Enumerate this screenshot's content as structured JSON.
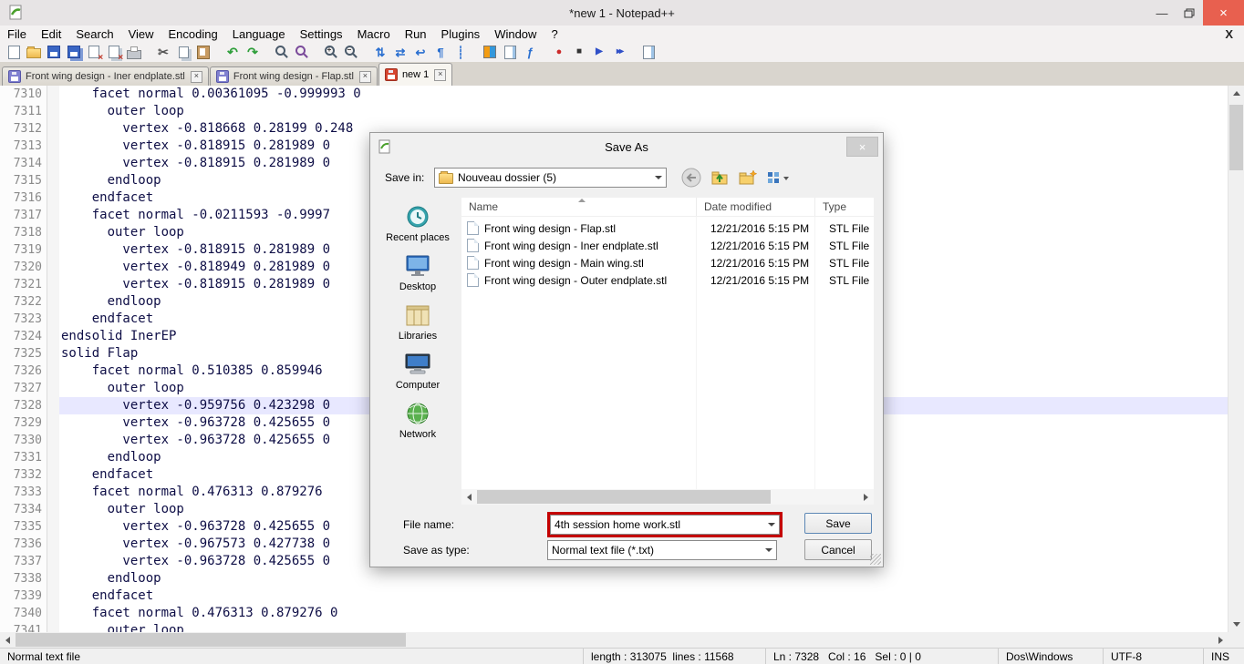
{
  "window": {
    "title": "*new 1 - Notepad++",
    "controls": {
      "minimize": "—",
      "close": "×"
    },
    "menu_close": "X"
  },
  "menu": [
    "File",
    "Edit",
    "Search",
    "View",
    "Encoding",
    "Language",
    "Settings",
    "Macro",
    "Run",
    "Plugins",
    "Window",
    "?"
  ],
  "toolbar": [
    {
      "name": "new-file-icon",
      "cls": "tbi-new",
      "glyph": ""
    },
    {
      "name": "open-file-icon",
      "cls": "tbi-open",
      "glyph": ""
    },
    {
      "name": "save-icon",
      "cls": "tbi-save",
      "glyph": ""
    },
    {
      "name": "save-all-icon",
      "cls": "tbi-saveall",
      "glyph": ""
    },
    {
      "name": "close-doc-icon",
      "cls": "tbi-close",
      "glyph": ""
    },
    {
      "name": "close-all-icon",
      "cls": "tbi-closeall",
      "glyph": ""
    },
    {
      "name": "print-icon",
      "cls": "tbi-print",
      "glyph": ""
    },
    {
      "name": "cut-icon",
      "cls": "tbi-cut gap",
      "glyph": "✂"
    },
    {
      "name": "copy-icon",
      "cls": "tbi-copy",
      "glyph": ""
    },
    {
      "name": "paste-icon",
      "cls": "tbi-paste",
      "glyph": ""
    },
    {
      "name": "undo-icon",
      "cls": "tbi-undo gap",
      "glyph": "↶"
    },
    {
      "name": "redo-icon",
      "cls": "tbi-redo",
      "glyph": "↷"
    },
    {
      "name": "find-icon",
      "cls": "tbi-find gap",
      "glyph": ""
    },
    {
      "name": "replace-icon",
      "cls": "tbi-replace",
      "glyph": ""
    },
    {
      "name": "zoom-in-icon",
      "cls": "tbi-zoomin gap",
      "glyph": ""
    },
    {
      "name": "zoom-out-icon",
      "cls": "tbi-zoomout",
      "glyph": ""
    },
    {
      "name": "sync-vertical-scroll-icon",
      "cls": "tbi-blue gap",
      "glyph": "⇅"
    },
    {
      "name": "sync-horizontal-scroll-icon",
      "cls": "tbi-blue",
      "glyph": "⇄"
    },
    {
      "name": "word-wrap-icon",
      "cls": "tbi-blue",
      "glyph": "↩"
    },
    {
      "name": "show-all-characters-icon",
      "cls": "tbi-blue",
      "glyph": "¶"
    },
    {
      "name": "indent-guide-icon",
      "cls": "tbi-blue",
      "glyph": "┊"
    },
    {
      "name": "user-defined-dialog-icon",
      "cls": "tbi-userdlg gap",
      "glyph": ""
    },
    {
      "name": "document-map-icon",
      "cls": "tbi-docmap",
      "glyph": ""
    },
    {
      "name": "function-list-icon",
      "cls": "tbi-func",
      "glyph": "ƒ"
    },
    {
      "name": "record-macro-icon",
      "cls": "tbi-record gap",
      "glyph": "●"
    },
    {
      "name": "stop-macro-icon",
      "cls": "tbi-stop",
      "glyph": "■"
    },
    {
      "name": "play-macro-icon",
      "cls": "tbi-play",
      "glyph": "▶"
    },
    {
      "name": "run-macro-multiple-icon",
      "cls": "tbi-multi",
      "glyph": "▸▸"
    },
    {
      "name": "save-recorded-macro-icon",
      "cls": "tbi-docmap gap",
      "glyph": ""
    }
  ],
  "tab_bar": {
    "close_glyph": "×",
    "tabs": [
      {
        "name": "tab-front-wing-iner-endplate",
        "label": "Front wing design - Iner endplate.stl",
        "cls": "saved"
      },
      {
        "name": "tab-front-wing-flap",
        "label": "Front wing design - Flap.stl",
        "cls": "saved"
      },
      {
        "name": "tab-new-1",
        "label": "new 1",
        "cls": "modified active"
      }
    ]
  },
  "editor": {
    "lines": [
      {
        "num": "7310",
        "text": "    facet normal 0.00361095 -0.999993 0"
      },
      {
        "num": "7311",
        "text": "      outer loop"
      },
      {
        "num": "7312",
        "text": "        vertex -0.818668 0.28199 0.248"
      },
      {
        "num": "7313",
        "text": "        vertex -0.818915 0.281989 0"
      },
      {
        "num": "7314",
        "text": "        vertex -0.818915 0.281989 0"
      },
      {
        "num": "7315",
        "text": "      endloop"
      },
      {
        "num": "7316",
        "text": "    endfacet"
      },
      {
        "num": "7317",
        "text": "    facet normal -0.0211593 -0.9997"
      },
      {
        "num": "7318",
        "text": "      outer loop"
      },
      {
        "num": "7319",
        "text": "        vertex -0.818915 0.281989 0"
      },
      {
        "num": "7320",
        "text": "        vertex -0.818949 0.281989 0"
      },
      {
        "num": "7321",
        "text": "        vertex -0.818915 0.281989 0"
      },
      {
        "num": "7322",
        "text": "      endloop"
      },
      {
        "num": "7323",
        "text": "    endfacet"
      },
      {
        "num": "7324",
        "text": "endsolid InerEP"
      },
      {
        "num": "7325",
        "text": "solid Flap"
      },
      {
        "num": "7326",
        "text": "    facet normal 0.510385 0.859946"
      },
      {
        "num": "7327",
        "text": "      outer loop"
      },
      {
        "num": "7328",
        "text": "        vertex -0.959756 0.423298 0",
        "cls": "current"
      },
      {
        "num": "7329",
        "text": "        vertex -0.963728 0.425655 0"
      },
      {
        "num": "7330",
        "text": "        vertex -0.963728 0.425655 0"
      },
      {
        "num": "7331",
        "text": "      endloop"
      },
      {
        "num": "7332",
        "text": "    endfacet"
      },
      {
        "num": "7333",
        "text": "    facet normal 0.476313 0.879276"
      },
      {
        "num": "7334",
        "text": "      outer loop"
      },
      {
        "num": "7335",
        "text": "        vertex -0.963728 0.425655 0"
      },
      {
        "num": "7336",
        "text": "        vertex -0.967573 0.427738 0"
      },
      {
        "num": "7337",
        "text": "        vertex -0.963728 0.425655 0"
      },
      {
        "num": "7338",
        "text": "      endloop"
      },
      {
        "num": "7339",
        "text": "    endfacet"
      },
      {
        "num": "7340",
        "text": "    facet normal 0.476313 0.879276 0"
      },
      {
        "num": "7341",
        "text": "      outer loop"
      }
    ]
  },
  "dialog": {
    "title": "Save As",
    "close_glyph": "×",
    "save_in_label": "Save in:",
    "save_in_value": "Nouveau dossier (5)",
    "nav_icons": [
      "back-icon",
      "up-one-level-icon",
      "new-folder-icon",
      "view-menu-icon"
    ],
    "places": [
      "Recent places",
      "Desktop",
      "Libraries",
      "Computer",
      "Network"
    ],
    "columns": {
      "name": "Name",
      "date": "Date modified",
      "type": "Type"
    },
    "files": [
      {
        "name": "Front wing design - Flap.stl",
        "date": "12/21/2016 5:15 PM",
        "type": "STL File"
      },
      {
        "name": "Front wing design - Iner endplate.stl",
        "date": "12/21/2016 5:15 PM",
        "type": "STL File"
      },
      {
        "name": "Front wing design - Main wing.stl",
        "date": "12/21/2016 5:15 PM",
        "type": "STL File"
      },
      {
        "name": "Front wing design - Outer endplate.stl",
        "date": "12/21/2016 5:15 PM",
        "type": "STL File"
      }
    ],
    "file_name_label": "File name:",
    "file_name_value": "4th session home work.stl",
    "save_as_type_label": "Save as type:",
    "save_as_type_value": "Normal text file (*.txt)",
    "save_button": "Save",
    "cancel_button": "Cancel",
    "annotation_color": "#c40000"
  },
  "status_bar": {
    "doc_type": "Normal text file",
    "length_info": "length : 313075  lines : 11568",
    "cursor_info": "Ln : 7328   Col : 16   Sel : 0 | 0",
    "eol_format": "Dos\\Windows",
    "encoding": "UTF-8",
    "insert_mode": "INS"
  }
}
